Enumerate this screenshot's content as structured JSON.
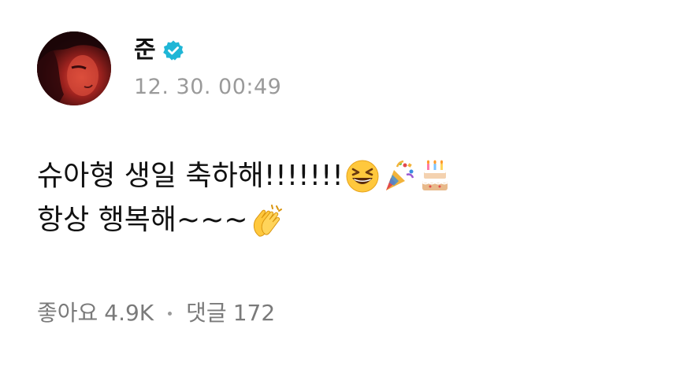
{
  "post": {
    "author": {
      "name": "준",
      "verified": true,
      "avatar": "profile-photo"
    },
    "timestamp": "12. 30. 00:49",
    "body": {
      "line1_text": "슈아형 생일 축하해!!!!!!!",
      "line1_emojis": [
        "grinning-squinting-face-icon",
        "party-popper-icon",
        "birthday-cake-icon"
      ],
      "line2_text": "항상 행복해~~~",
      "line2_emojis": [
        "clapping-hands-icon"
      ]
    },
    "stats": {
      "likes_label": "좋아요",
      "likes_count": "4.9K",
      "comments_label": "댓글",
      "comments_count": "172"
    },
    "colors": {
      "verified": "#1fb6d6",
      "timestamp": "#9a9a9a",
      "stats": "#7a7a7a"
    }
  }
}
